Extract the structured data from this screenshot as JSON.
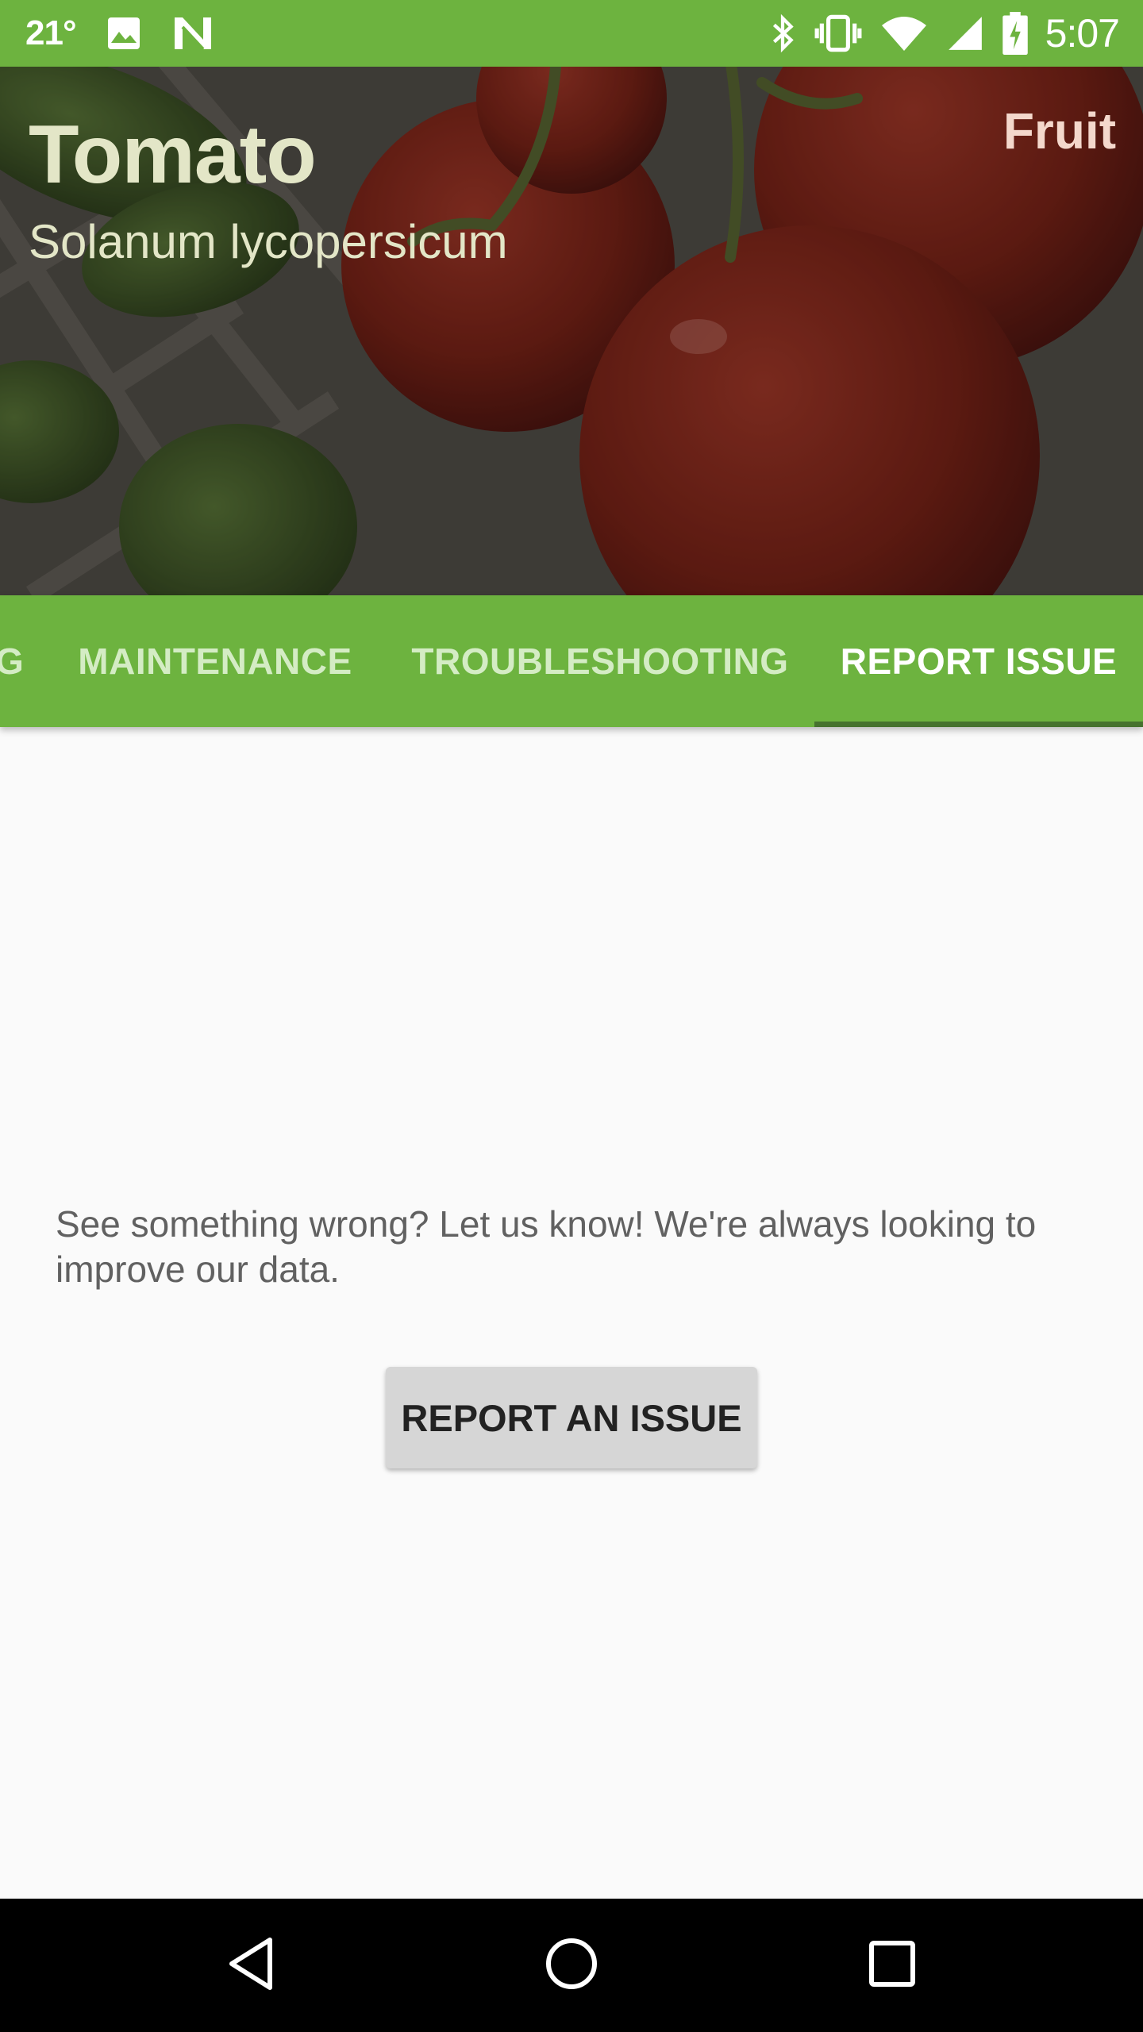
{
  "status_bar": {
    "temperature": "21°",
    "time": "5:07",
    "icons": [
      "image-icon",
      "n-app-icon",
      "bluetooth-icon",
      "vibrate-icon",
      "wifi-icon",
      "cell-signal-icon",
      "battery-charging-icon"
    ]
  },
  "header": {
    "title": "Tomato",
    "subtitle": "Solanum lycopersicum",
    "category": "Fruit"
  },
  "tabs": [
    {
      "label": "G"
    },
    {
      "label": "MAINTENANCE"
    },
    {
      "label": "TROUBLESHOOTING"
    },
    {
      "label": "REPORT ISSUE",
      "active": true
    }
  ],
  "content": {
    "message": "See something wrong? Let us know! We're always looking to improve our data.",
    "button_label": "REPORT AN ISSUE"
  },
  "nav_bar": {
    "icons": [
      "back-icon",
      "home-icon",
      "recents-icon"
    ]
  },
  "colors": {
    "primary": "#6db33f",
    "tab_indicator": "#46722e",
    "background": "#fafafa"
  }
}
